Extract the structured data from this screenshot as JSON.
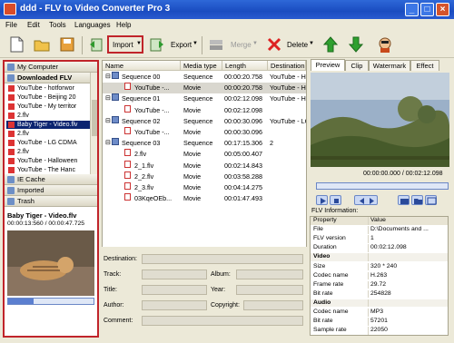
{
  "window": {
    "title": "ddd - FLV to Video Converter Pro 3",
    "min": "_",
    "max": "□",
    "close": "×"
  },
  "menu": [
    "File",
    "Edit",
    "Tools",
    "Languages",
    "Help"
  ],
  "toolbar": {
    "import": "Import",
    "export": "Export",
    "merge": "Merge",
    "delete": "Delete"
  },
  "left": {
    "my_computer": "My Computer",
    "downloaded": "Downloaded FLV",
    "items": [
      "YouTube - hotforwor",
      "YouTube - Beijing 20",
      "YouTube - My territor",
      "2.flv",
      "Baby Tiger - Video.flv",
      "2.flv",
      "YouTube - LG CDMA",
      "2.flv",
      "YouTube - Halloween",
      "YouTube - The Hanc"
    ],
    "ie_cache": "IE Cache",
    "imported": "Imported",
    "trash": "Trash",
    "preview_title": "Baby Tiger - Video.flv",
    "preview_time": "00:00:13:560 / 00:00:47.725"
  },
  "center": {
    "cols": [
      "Name",
      "Media type",
      "Length",
      "Destination"
    ],
    "rows": [
      {
        "name": "Sequence 00",
        "type": "Sequence",
        "len": "00:00:20.758",
        "dest": "YouTube - H"
      },
      {
        "name": "YouTube -...",
        "type": "Movie",
        "len": "00:00:20.758",
        "dest": "YouTube - H"
      },
      {
        "name": "Sequence 01",
        "type": "Sequence",
        "len": "00:02:12.098",
        "dest": "YouTube - H"
      },
      {
        "name": "YouTube -...",
        "type": "Movie",
        "len": "00:02:12.098",
        "dest": ""
      },
      {
        "name": "Sequence 02",
        "type": "Sequence",
        "len": "00:00:30.096",
        "dest": "YouTube - LG"
      },
      {
        "name": "YouTube -...",
        "type": "Movie",
        "len": "00:00:30.096",
        "dest": ""
      },
      {
        "name": "Sequence 03",
        "type": "Sequence",
        "len": "00:17:15.306",
        "dest": "2"
      },
      {
        "name": "2.flv",
        "type": "Movie",
        "len": "00:05:00.407",
        "dest": ""
      },
      {
        "name": "2_1.flv",
        "type": "Movie",
        "len": "00:02:14.843",
        "dest": ""
      },
      {
        "name": "2_2.flv",
        "type": "Movie",
        "len": "00:03:58.288",
        "dest": ""
      },
      {
        "name": "2_3.flv",
        "type": "Movie",
        "len": "00:04:14.275",
        "dest": ""
      },
      {
        "name": "03KqeOEb...",
        "type": "Movie",
        "len": "00:01:47.493",
        "dest": ""
      }
    ]
  },
  "form": {
    "destination": "Destination:",
    "track": "Track:",
    "album": "Album:",
    "title": "Title:",
    "year": "Year:",
    "author": "Author:",
    "copyright": "Copyright:",
    "comment": "Comment:"
  },
  "right": {
    "tabs": [
      "Preview",
      "Clip",
      "Watermark",
      "Effect"
    ],
    "time": "00:00:00.000 / 00:02:12.098",
    "flv_info": "FLV Information:",
    "props": [
      {
        "k": "Property",
        "v": "Value",
        "h": true
      },
      {
        "k": "File",
        "v": "D:\\Documents and ..."
      },
      {
        "k": "FLV version",
        "v": "1"
      },
      {
        "k": "Duration",
        "v": "00:02:12.098"
      },
      {
        "k": "Video",
        "v": "",
        "g": true
      },
      {
        "k": "Size",
        "v": "320 * 240"
      },
      {
        "k": "Codec name",
        "v": "H.263"
      },
      {
        "k": "Frame rate",
        "v": "29.72"
      },
      {
        "k": "Bit rate",
        "v": "254828"
      },
      {
        "k": "Audio",
        "v": "",
        "g": true
      },
      {
        "k": "Codec name",
        "v": "MP3"
      },
      {
        "k": "Bit rate",
        "v": "57201"
      },
      {
        "k": "Sample rate",
        "v": "22050"
      }
    ]
  }
}
